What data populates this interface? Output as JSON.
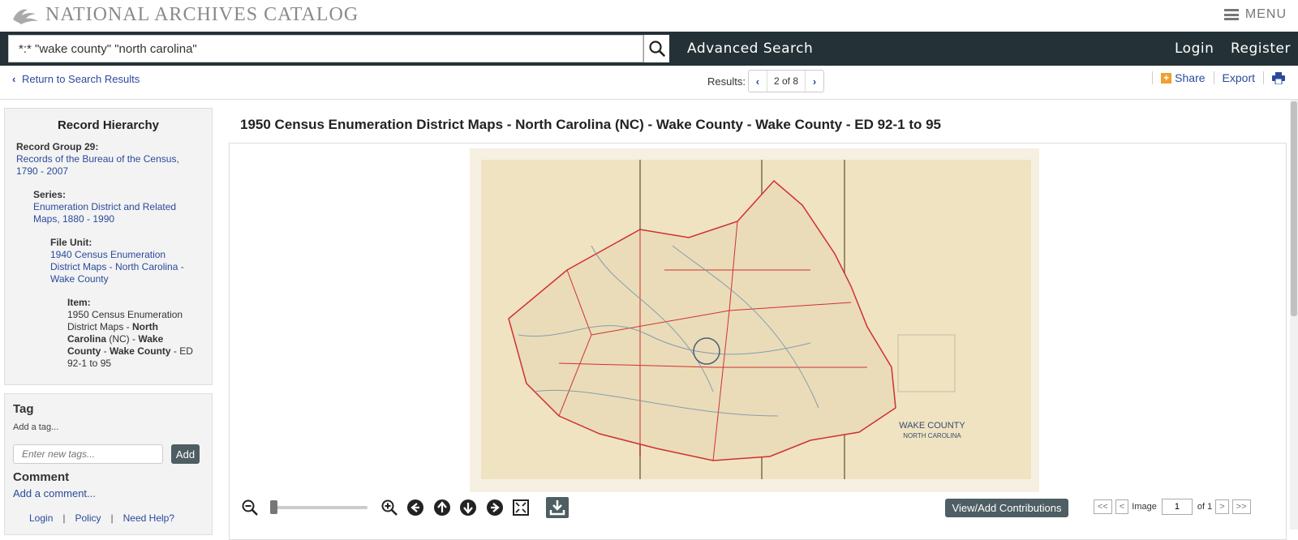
{
  "header": {
    "site_title": "NATIONAL ARCHIVES CATALOG",
    "menu_label": "MENU"
  },
  "nav": {
    "search_value": "*:* \"wake county\" \"north carolina\"",
    "advanced_search": "Advanced Search",
    "login": "Login",
    "register": "Register"
  },
  "subbar": {
    "return_label": "Return to Search Results",
    "results_label": "Results:",
    "results_count": "2 of 8",
    "share": "Share",
    "export": "Export"
  },
  "hierarchy": {
    "title": "Record Hierarchy",
    "record_group_label": "Record Group 29:",
    "record_group_line1": "Records of the Bureau of the Census,",
    "record_group_line2": "1790 - 2007",
    "series_label": "Series:",
    "series_line1": "Enumeration District and Related",
    "series_line2": "Maps, 1880 - 1990",
    "file_unit_label": "File Unit:",
    "file_unit_line1": "1940 Census Enumeration",
    "file_unit_line2": "District Maps - North Carolina -",
    "file_unit_line3": "Wake County",
    "item_label": "Item:",
    "item_line1": "1950 Census Enumeration",
    "item_line2a": "District Maps - ",
    "item_line2b": "North",
    "item_line3a": "Carolina",
    "item_line3b": " (NC) - ",
    "item_line3c": "Wake",
    "item_line4a": "County",
    "item_line4b": " - ",
    "item_line4c": "Wake County",
    "item_line4d": " - ED",
    "item_line5": "92-1 to 95"
  },
  "tag": {
    "title": "Tag",
    "prompt": "Add a tag...",
    "placeholder": "Enter new tags...",
    "add_label": "Add"
  },
  "comment": {
    "title": "Comment",
    "link": "Add a comment..."
  },
  "footer_links": [
    "Login",
    "Policy",
    "Need Help?"
  ],
  "record": {
    "title": "1950 Census Enumeration District Maps - North Carolina (NC) - Wake County - Wake County - ED 92-1 to 95"
  },
  "viewer": {
    "map_title": "WAKE COUNTY",
    "map_subtitle": "NORTH CAROLINA",
    "contributions_label": "View/Add Contributions",
    "first": "<<",
    "prev": "<",
    "image_label": "Image",
    "page_value": "1",
    "of_label": "of 1",
    "next": ">",
    "last": ">>"
  },
  "icons": [
    "eagle-logo-icon",
    "hamburger-icon",
    "search-icon",
    "chevron-left-icon",
    "chevron-right-icon",
    "plus-icon",
    "print-icon",
    "zoom-out-icon",
    "zoom-in-icon",
    "arrow-left-icon",
    "arrow-up-icon",
    "arrow-down-icon",
    "arrow-right-icon",
    "fit-screen-icon",
    "download-icon"
  ],
  "colors": {
    "navbar": "#243237",
    "link": "#2b4a9c",
    "button": "#4e5e63",
    "share_accent": "#f0a030",
    "map_paper": "#efe3c2",
    "map_lines": "#d03030"
  }
}
